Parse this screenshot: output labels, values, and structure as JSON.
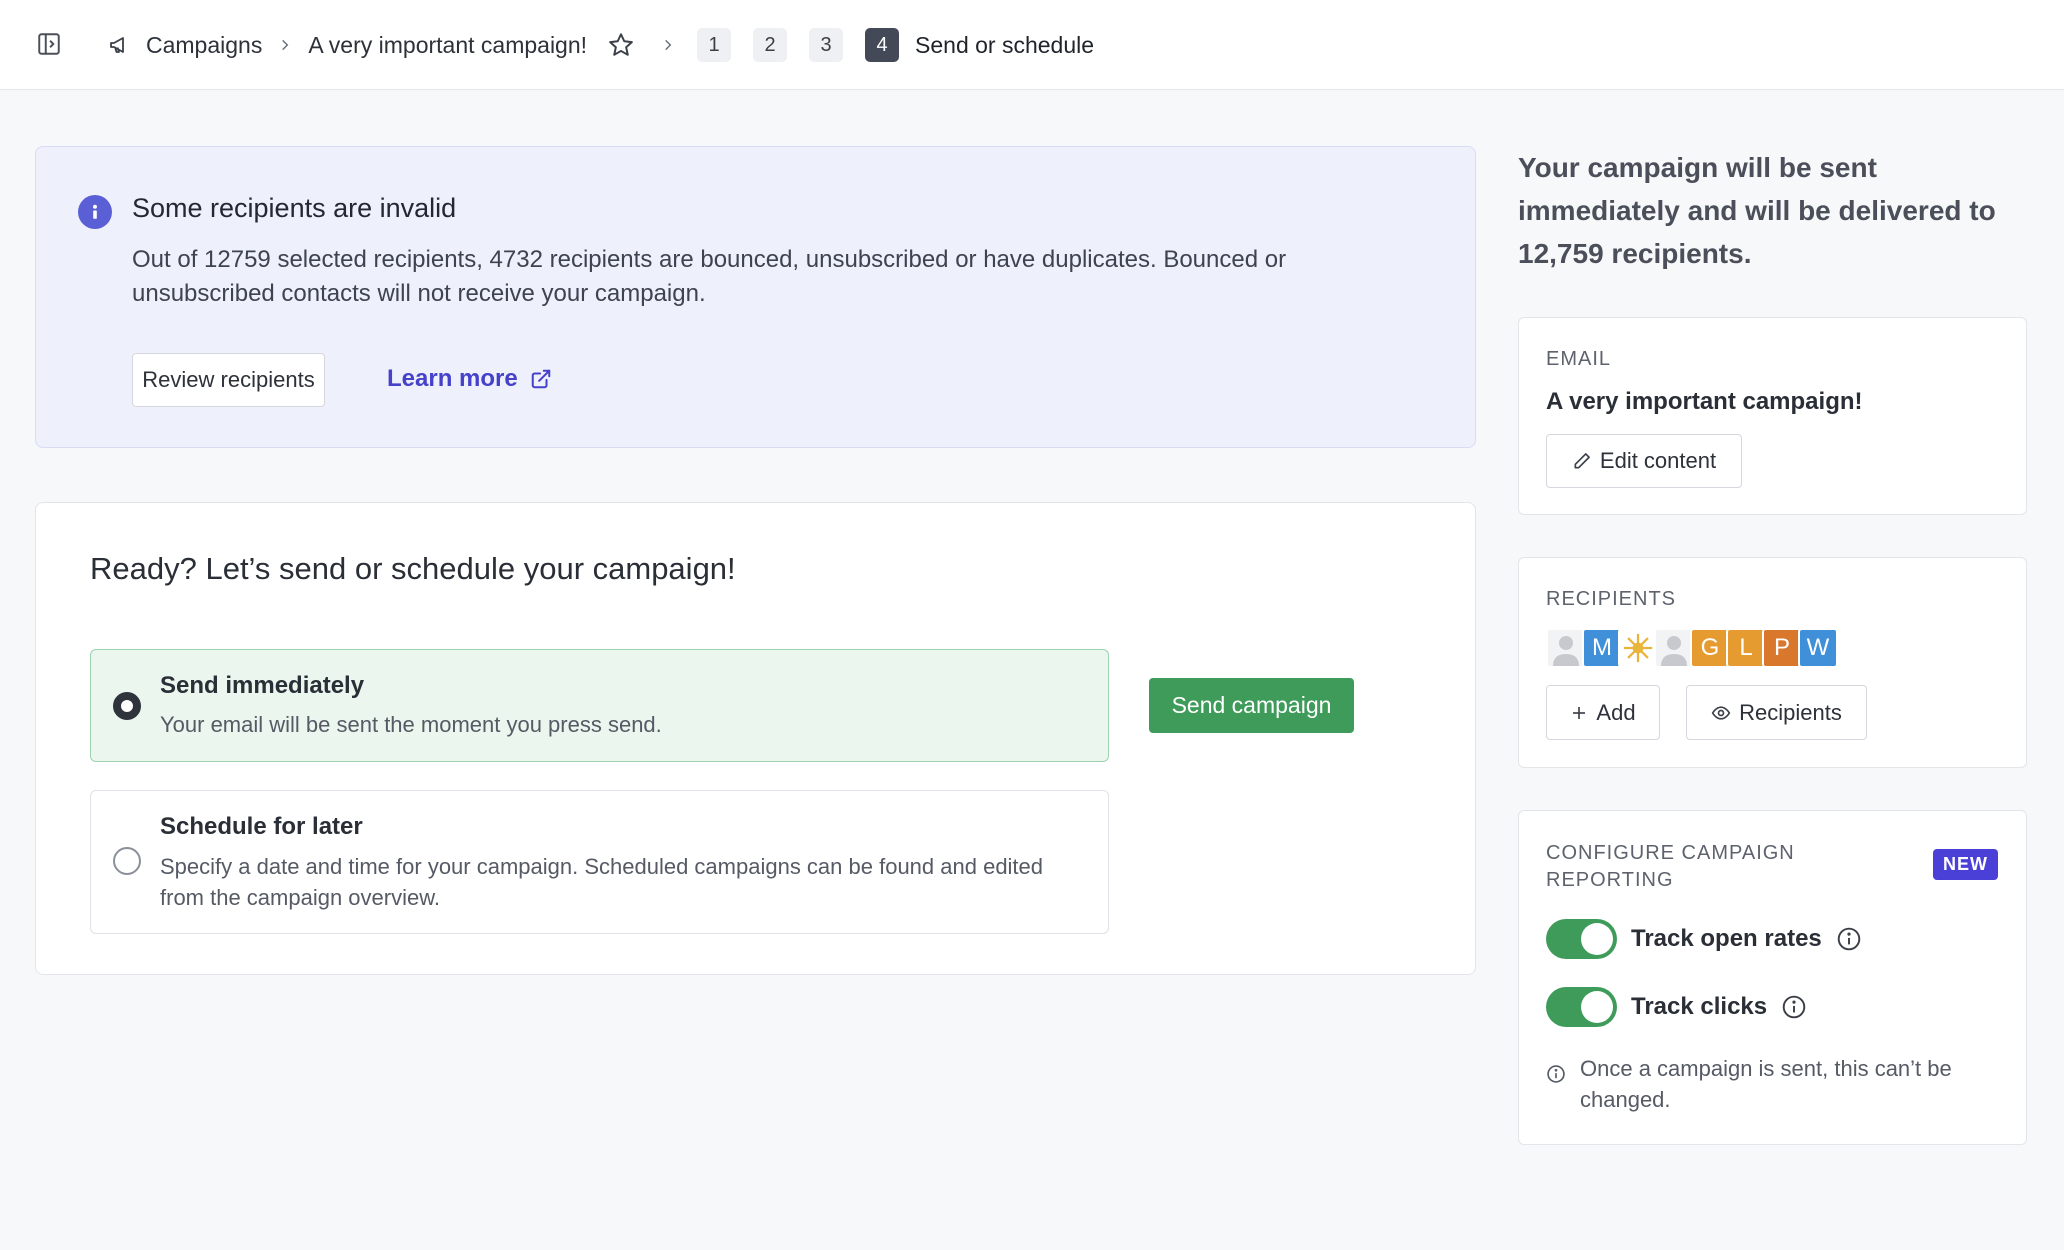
{
  "breadcrumb": {
    "campaigns": "Campaigns",
    "campaign_name": "A very important campaign!",
    "steps": [
      "1",
      "2",
      "3",
      "4"
    ],
    "current_step_label": "Send or schedule"
  },
  "alert": {
    "title": "Some recipients are invalid",
    "text": "Out of 12759 selected recipients, 4732 recipients are bounced, unsubscribed or have duplicates. Bounced or unsubscribed contacts will not receive your campaign.",
    "review_label": "Review recipients",
    "learn_more_label": "Learn more"
  },
  "send": {
    "title": "Ready? Let’s send or schedule your campaign!",
    "options": [
      {
        "title": "Send immediately",
        "desc": "Your email will be sent the moment you press send.",
        "selected": true
      },
      {
        "title": "Schedule for later",
        "desc": "Specify a date and time for your campaign. Scheduled campaigns can be found and edited from the campaign overview.",
        "selected": false
      }
    ],
    "send_button": "Send campaign"
  },
  "summary": "Your campaign will be sent immediately and will be delivered to 12,759 recipients.",
  "email_panel": {
    "label": "Email",
    "subject": "A very important campaign!",
    "edit_label": "Edit content"
  },
  "recipients_panel": {
    "label": "Recipients",
    "avatars": [
      "",
      "M",
      "",
      "",
      "G",
      "L",
      "P",
      "W"
    ],
    "add_label": "Add",
    "recipients_label": "Recipients"
  },
  "reporting_panel": {
    "label": "Configure campaign reporting",
    "badge": "NEW",
    "track_open_label": "Track open rates",
    "track_open_on": true,
    "track_clicks_label": "Track clicks",
    "track_clicks_on": true,
    "note": "Once a campaign is sent, this can’t be changed."
  },
  "colors": {
    "accent": "#4542c9",
    "success": "#3f9b5a",
    "badge": "#4a3fd6"
  }
}
